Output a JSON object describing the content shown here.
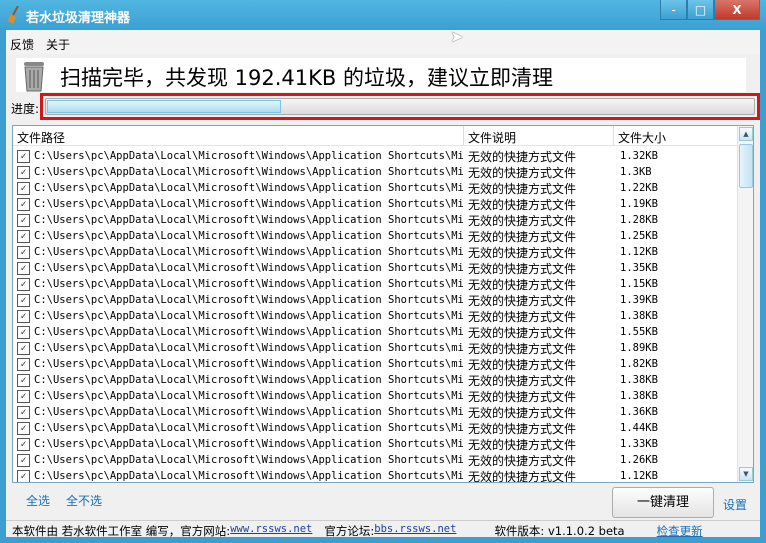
{
  "window": {
    "title": "若水垃圾清理神器",
    "minimize": "-",
    "maximize": "□",
    "close": "X"
  },
  "menu": [
    "反馈",
    "关于"
  ],
  "header": {
    "message": "扫描完毕，共发现 192.41KB 的垃圾，建议立即清理"
  },
  "progress": {
    "label": "进度:",
    "percent": 33
  },
  "table": {
    "columns": [
      "文件路径",
      "文件说明",
      "文件大小"
    ],
    "rows": [
      {
        "path": "C:\\Users\\pc\\AppData\\Local\\Microsoft\\Windows\\Application Shortcuts\\Mi...",
        "desc": "无效的快捷方式文件",
        "size": "1.32KB"
      },
      {
        "path": "C:\\Users\\pc\\AppData\\Local\\Microsoft\\Windows\\Application Shortcuts\\Mi...",
        "desc": "无效的快捷方式文件",
        "size": "1.3KB"
      },
      {
        "path": "C:\\Users\\pc\\AppData\\Local\\Microsoft\\Windows\\Application Shortcuts\\Mi...",
        "desc": "无效的快捷方式文件",
        "size": "1.22KB"
      },
      {
        "path": "C:\\Users\\pc\\AppData\\Local\\Microsoft\\Windows\\Application Shortcuts\\Mi...",
        "desc": "无效的快捷方式文件",
        "size": "1.19KB"
      },
      {
        "path": "C:\\Users\\pc\\AppData\\Local\\Microsoft\\Windows\\Application Shortcuts\\Mi...",
        "desc": "无效的快捷方式文件",
        "size": "1.28KB"
      },
      {
        "path": "C:\\Users\\pc\\AppData\\Local\\Microsoft\\Windows\\Application Shortcuts\\Mi...",
        "desc": "无效的快捷方式文件",
        "size": "1.25KB"
      },
      {
        "path": "C:\\Users\\pc\\AppData\\Local\\Microsoft\\Windows\\Application Shortcuts\\Mi...",
        "desc": "无效的快捷方式文件",
        "size": "1.12KB"
      },
      {
        "path": "C:\\Users\\pc\\AppData\\Local\\Microsoft\\Windows\\Application Shortcuts\\Mi...",
        "desc": "无效的快捷方式文件",
        "size": "1.35KB"
      },
      {
        "path": "C:\\Users\\pc\\AppData\\Local\\Microsoft\\Windows\\Application Shortcuts\\Mi...",
        "desc": "无效的快捷方式文件",
        "size": "1.15KB"
      },
      {
        "path": "C:\\Users\\pc\\AppData\\Local\\Microsoft\\Windows\\Application Shortcuts\\Mi...",
        "desc": "无效的快捷方式文件",
        "size": "1.39KB"
      },
      {
        "path": "C:\\Users\\pc\\AppData\\Local\\Microsoft\\Windows\\Application Shortcuts\\Mi...",
        "desc": "无效的快捷方式文件",
        "size": "1.38KB"
      },
      {
        "path": "C:\\Users\\pc\\AppData\\Local\\Microsoft\\Windows\\Application Shortcuts\\Mi...",
        "desc": "无效的快捷方式文件",
        "size": "1.55KB"
      },
      {
        "path": "C:\\Users\\pc\\AppData\\Local\\Microsoft\\Windows\\Application Shortcuts\\mi...",
        "desc": "无效的快捷方式文件",
        "size": "1.89KB"
      },
      {
        "path": "C:\\Users\\pc\\AppData\\Local\\Microsoft\\Windows\\Application Shortcuts\\mi...",
        "desc": "无效的快捷方式文件",
        "size": "1.82KB"
      },
      {
        "path": "C:\\Users\\pc\\AppData\\Local\\Microsoft\\Windows\\Application Shortcuts\\Mi...",
        "desc": "无效的快捷方式文件",
        "size": "1.38KB"
      },
      {
        "path": "C:\\Users\\pc\\AppData\\Local\\Microsoft\\Windows\\Application Shortcuts\\Mi...",
        "desc": "无效的快捷方式文件",
        "size": "1.38KB"
      },
      {
        "path": "C:\\Users\\pc\\AppData\\Local\\Microsoft\\Windows\\Application Shortcuts\\Mi...",
        "desc": "无效的快捷方式文件",
        "size": "1.36KB"
      },
      {
        "path": "C:\\Users\\pc\\AppData\\Local\\Microsoft\\Windows\\Application Shortcuts\\Mi...",
        "desc": "无效的快捷方式文件",
        "size": "1.44KB"
      },
      {
        "path": "C:\\Users\\pc\\AppData\\Local\\Microsoft\\Windows\\Application Shortcuts\\Mi...",
        "desc": "无效的快捷方式文件",
        "size": "1.33KB"
      },
      {
        "path": "C:\\Users\\pc\\AppData\\Local\\Microsoft\\Windows\\Application Shortcuts\\Mi...",
        "desc": "无效的快捷方式文件",
        "size": "1.26KB"
      },
      {
        "path": "C:\\Users\\pc\\AppData\\Local\\Microsoft\\Windows\\Application Shortcuts\\Mi...",
        "desc": "无效的快捷方式文件",
        "size": "1.12KB"
      }
    ]
  },
  "actions": {
    "select_all": "全选",
    "select_none": "全不选",
    "clean": "一键清理",
    "settings": "设置"
  },
  "status": {
    "prefix": "本软件由 若水软件工作室 编写，官方网站:",
    "website": "www.rssws.net",
    "forum_label": "官方论坛:",
    "forum": "bbs.rssws.net",
    "version": "软件版本: v1.1.0.2 beta",
    "check_update": "检查更新"
  }
}
